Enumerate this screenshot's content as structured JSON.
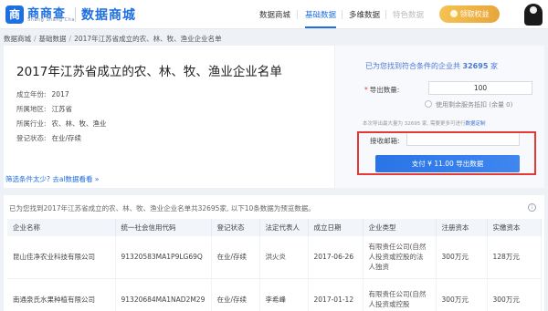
{
  "header": {
    "logo_mark": "商",
    "logo_text": "商商查",
    "logo_sub": "Shang Shang Cha",
    "logo_title": "数据商城",
    "nav": [
      {
        "label": "数据商城"
      },
      {
        "label": "基础数据"
      },
      {
        "label": "多维数据"
      },
      {
        "label": "特色数据"
      }
    ],
    "vip_label": "领取权益"
  },
  "breadcrumb": {
    "items": [
      "数据商城",
      "基础数据",
      "2017年江苏省成立的农、林、牧、渔业企业名单"
    ],
    "separator": "/"
  },
  "detail": {
    "title": "2017年江苏省成立的农、林、牧、渔业企业名单",
    "fields": [
      {
        "key": "成立年份:",
        "value": "2017"
      },
      {
        "key": "所属地区:",
        "value": "江苏省"
      },
      {
        "key": "所属行业:",
        "value": "农、林、牧、渔业"
      },
      {
        "key": "登记状态:",
        "value": "在业/存续"
      }
    ],
    "filter_link": "筛选条件太少? 去al数据看看 »"
  },
  "order": {
    "found_prefix": "已为您找到符合条件的企业共",
    "found_count": "32695",
    "found_suffix": "家",
    "qty_required": "*",
    "qty_label": "导出数量:",
    "qty_value": "100",
    "use_remaining_label": "使用剩余服务抵扣 (余量 0)",
    "note_prefix": "本次导出最大量为",
    "note_count": "32695",
    "note_mid": "家, 需要更多可进行",
    "note_link": "数据定制",
    "email_label": "接收邮箱:",
    "email_value": "",
    "pay_label": "支付 ¥ 11.00 导出数据"
  },
  "results": {
    "note": "已为您找到2017年江苏省成立的农、林、牧、渔业企业名单共32695家, 以下10条数据为预览数据。",
    "info_icon": "i",
    "columns": [
      "企业名称",
      "统一社会信用代码",
      "登记状态",
      "法定代表人",
      "成立日期",
      "企业类型",
      "注册资本",
      "实缴资本"
    ],
    "rows": [
      [
        "昆山佳净农业科技有限公司",
        "91320583MA1P9LG69Q",
        "在业/存续",
        "洪火炎",
        "2017-06-26",
        "有限责任公司(自然人投资或控股的法人独资",
        "300万元",
        "128万元"
      ],
      [
        "南通泉氏水果种植有限公司",
        "91320684MA1NAD2M29",
        "在业/存续",
        "李希峰",
        "2017-01-12",
        "有限责任公司(自然人投资或控股",
        "300万元",
        "300万元"
      ]
    ]
  }
}
